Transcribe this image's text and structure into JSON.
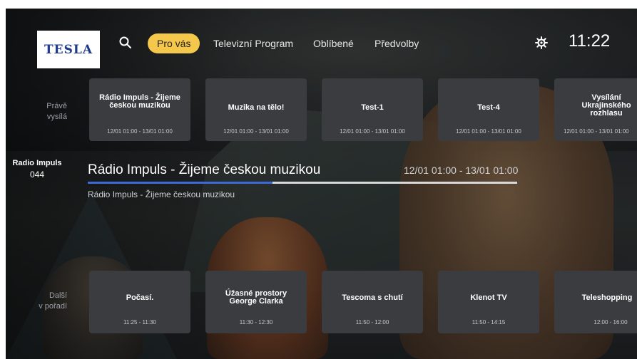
{
  "header": {
    "logo_text": "TESLA",
    "search_icon": "search-icon",
    "tabs": [
      {
        "label": "Pro vás",
        "active": true
      },
      {
        "label": "Televizní Program",
        "active": false
      },
      {
        "label": "Oblíbené",
        "active": false
      },
      {
        "label": "Předvolby",
        "active": false
      }
    ],
    "settings_icon": "gear-icon",
    "clock": "11:22"
  },
  "colors": {
    "accent": "#f5c84c",
    "progress": "#3d6bd6",
    "card_bg": "#3a3c40",
    "logo_text": "#1e3a8a"
  },
  "now_row": {
    "label_line1": "Právě",
    "label_line2": "vysílá",
    "cards": [
      {
        "title": "Rádio Impuls - Žijeme českou muzikou",
        "time": "12/01 01:00 - 13/01 01:00"
      },
      {
        "title": "Muzika na tělo!",
        "time": "12/01 01:00 - 13/01 01:00"
      },
      {
        "title": "Test-1",
        "time": "12/01 01:00 - 13/01 01:00"
      },
      {
        "title": "Test-4",
        "time": "12/01 01:00 - 13/01 01:00"
      },
      {
        "title": "Vysílání Ukrajinského rozhlasu",
        "time": "12/01 01:00 - 13/01 01:00"
      }
    ]
  },
  "selected_channel": {
    "name": "Radio Impuls",
    "number": "044",
    "program_title": "Rádio Impuls - Žijeme českou muzikou",
    "program_time": "12/01 01:00 - 13/01 01:00",
    "description": "Rádio Impuls - Žijeme českou muzikou",
    "progress": 0.43
  },
  "next_row": {
    "label_line1": "Další",
    "label_line2": "v pořadí",
    "cards": [
      {
        "title": "Počasí.",
        "time": "11:25 - 11:30"
      },
      {
        "title": "Úžasné prostory George Clarka",
        "time": "11:30 - 12:30"
      },
      {
        "title": "Tescoma s chutí",
        "time": "11:50 - 12:00"
      },
      {
        "title": "Klenot TV",
        "time": "11:50 - 14:15"
      },
      {
        "title": "Teleshopping",
        "time": "12:00 - 16:00"
      }
    ]
  }
}
